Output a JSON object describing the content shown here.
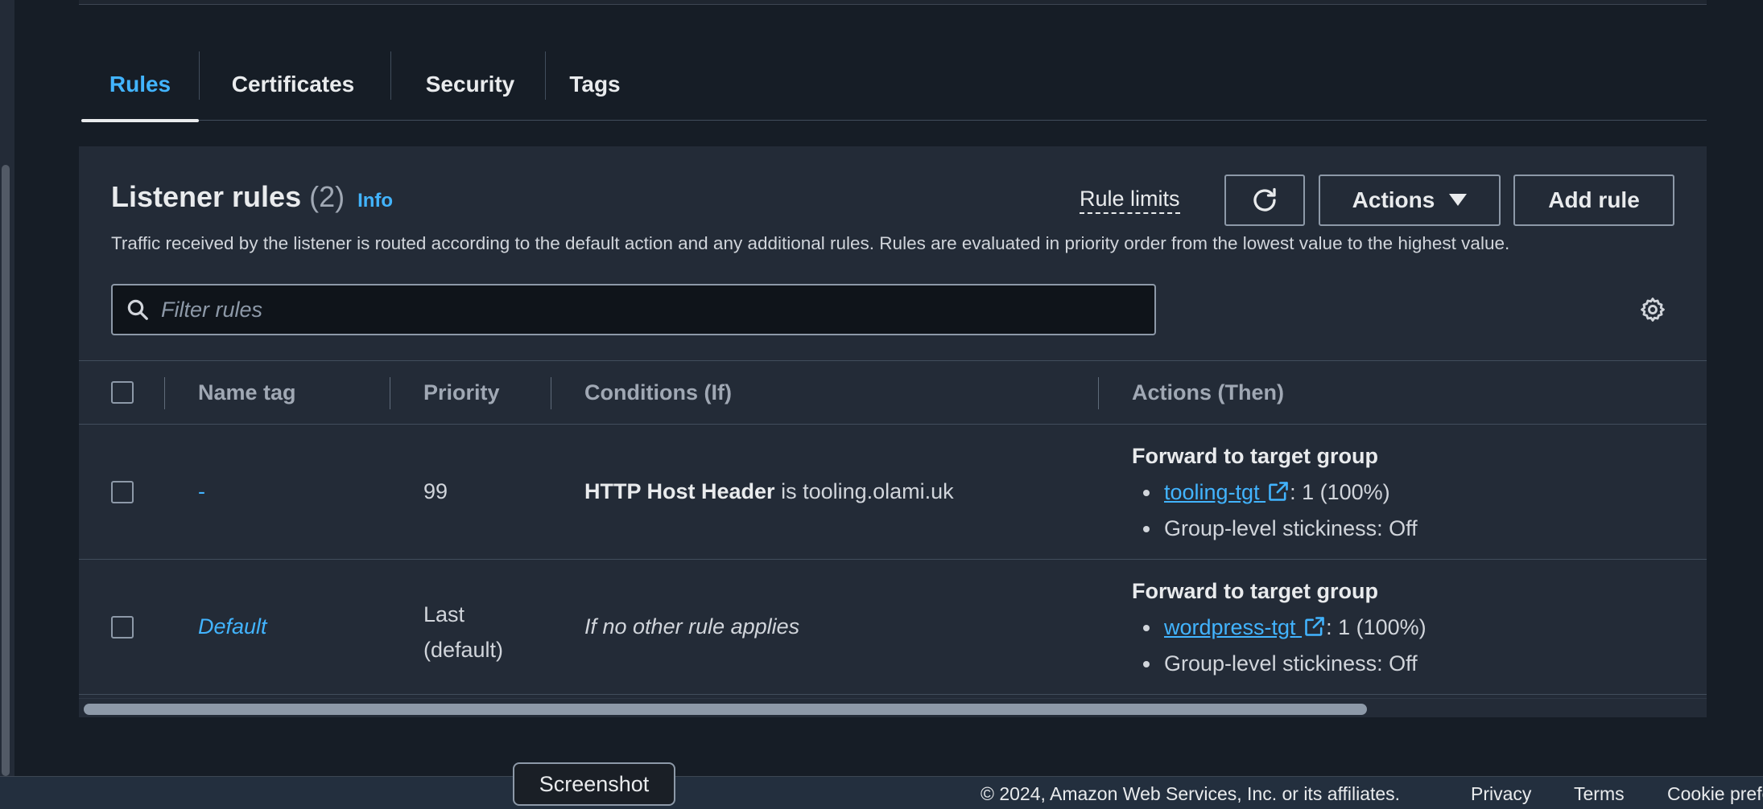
{
  "tabs": [
    {
      "label": "Rules",
      "active": true
    },
    {
      "label": "Certificates",
      "active": false
    },
    {
      "label": "Security",
      "active": false
    },
    {
      "label": "Tags",
      "active": false
    }
  ],
  "panel": {
    "title": "Listener rules",
    "count": "(2)",
    "info": "Info",
    "description": "Traffic received by the listener is routed according to the default action and any additional rules. Rules are evaluated in priority order from the lowest value to the highest value.",
    "rule_limits": "Rule limits",
    "actions_label": "Actions",
    "add_rule_label": "Add rule",
    "filter_placeholder": "Filter rules"
  },
  "table": {
    "columns": [
      "Name tag",
      "Priority",
      "Conditions (If)",
      "Actions (Then)"
    ],
    "rows": [
      {
        "name": "-",
        "priority_line1": "99",
        "priority_line2": "",
        "condition_key": "HTTP Host Header",
        "condition_op": " is ",
        "condition_value": "tooling.olami.uk",
        "action_title": "Forward to target group",
        "target": "tooling-tgt",
        "target_weight": ": 1 (100%)",
        "stickiness": "Group-level stickiness: Off"
      },
      {
        "name": "Default",
        "priority_line1": "Last",
        "priority_line2": "(default)",
        "condition_text": "If no other rule applies",
        "action_title": "Forward to target group",
        "target": "wordpress-tgt",
        "target_weight": ": 1 (100%)",
        "stickiness": "Group-level stickiness: Off"
      }
    ]
  },
  "footer": {
    "copyright": "© 2024, Amazon Web Services, Inc. or its affiliates.",
    "privacy": "Privacy",
    "terms": "Terms",
    "cookie": "Cookie preferences"
  },
  "tooltip": "Screenshot",
  "colors": {
    "background": "#161d26",
    "panel": "#232b37",
    "accent_link": "#42b4ff",
    "text_primary": "#e9ebed"
  }
}
